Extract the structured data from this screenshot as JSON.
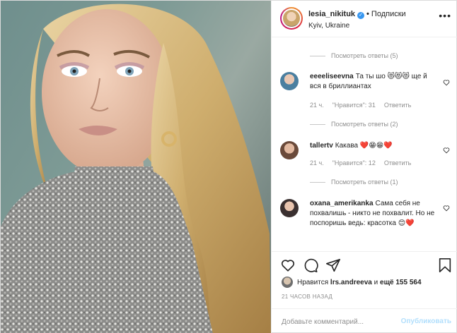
{
  "header": {
    "username": "lesia_nikituk",
    "separator": "•",
    "follow_label": "Подписки",
    "location": "Kyiv, Ukraine",
    "more_icon": "more-horizontal-icon"
  },
  "comments": {
    "replies_top": "Посмотреть ответы (5)",
    "items": [
      {
        "user": "eeeeliseevna",
        "text": "Та ты шо 😻😻😻 ще й вся в бриллиантах",
        "time": "21 ч.",
        "likes": "\"Нравится\": 31",
        "reply": "Ответить",
        "replies": "Посмотреть ответы (2)",
        "avatar_color": "#4a7fa0"
      },
      {
        "user": "tallertv",
        "text": "Какава ❤️😁😁❤️",
        "time": "21 ч.",
        "likes": "\"Нравится\": 12",
        "reply": "Ответить",
        "replies": "Посмотреть ответы (1)",
        "avatar_color": "#6a4a3a"
      },
      {
        "user": "oxana_amerikanka",
        "text": "Сама себя не похвалишь - никто не похвалит. Но не поспоришь ведь: красотка 😊❤️",
        "avatar_color": "#3a3030"
      }
    ]
  },
  "actions": {
    "like_icon": "heart-icon",
    "comment_icon": "comment-icon",
    "share_icon": "share-icon",
    "save_icon": "bookmark-icon"
  },
  "likes": {
    "prefix": "Нравится",
    "user": "lrs.andreeva",
    "middle": "и",
    "count": "ещё 155 564"
  },
  "timestamp": "21 ЧАСОВ НАЗАД",
  "add_comment": {
    "placeholder": "Добавьте комментарий...",
    "publish_label": "Опубликовать"
  },
  "colors": {
    "accent": "#3897f0",
    "publish_disabled": "#b2dffc",
    "secondary_text": "#8e8e8e"
  }
}
